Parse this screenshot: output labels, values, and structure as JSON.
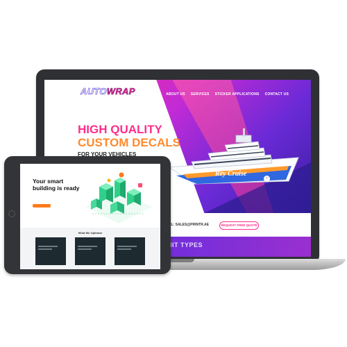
{
  "laptop": {
    "logo": {
      "auto": "AUTO",
      "wrap": "WRAP"
    },
    "nav": [
      "ABOUT US",
      "SERVICES",
      "STICKER APPLICATIONS",
      "CONTACT US"
    ],
    "headline": [
      "HIGH QUALITY",
      "CUSTOM DECALS",
      "FOR YOUR VEHICLES"
    ],
    "yacht_name": "Rey Cruise",
    "email": "EMAIL: SALES@PRINTR.AE",
    "quote_button": "REQUEST FREE QUOTE",
    "section_title": "PERMIT TYPES"
  },
  "tablet": {
    "headline": "Your smart building is ready",
    "section_title": "What We Optimize"
  },
  "colors": {
    "accent_pink": "#ff2d8a",
    "accent_orange": "#ff8a2d",
    "tablet_green": "#2fd18a",
    "tablet_button": "#ff7a1a"
  }
}
